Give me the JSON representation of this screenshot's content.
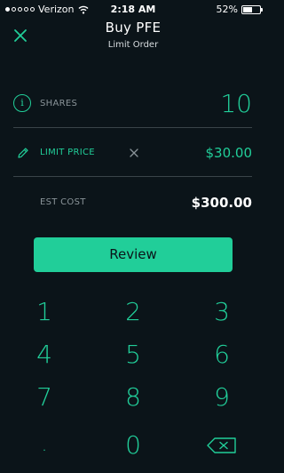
{
  "status_bar": {
    "carrier": "Verizon",
    "time": "2:18 AM",
    "battery": "52%"
  },
  "header": {
    "title": "Buy PFE",
    "subtitle": "Limit Order"
  },
  "order": {
    "shares_label": "SHARES",
    "shares_value": "10",
    "limit_label": "LIMIT PRICE",
    "limit_value": "$30.00",
    "est_label": "EST COST",
    "est_value": "$300.00"
  },
  "review_button": "Review",
  "keypad": {
    "keys": [
      "1",
      "2",
      "3",
      "4",
      "5",
      "6",
      "7",
      "8",
      "9",
      ".",
      "0"
    ]
  },
  "colors": {
    "accent": "#21ce99",
    "background": "#0b1419"
  },
  "icons": {
    "close": "close-icon",
    "info": "info-icon",
    "pencil": "pencil-icon",
    "clear": "clear-icon",
    "backspace": "backspace-icon",
    "wifi": "wifi-icon",
    "battery": "battery-icon"
  }
}
